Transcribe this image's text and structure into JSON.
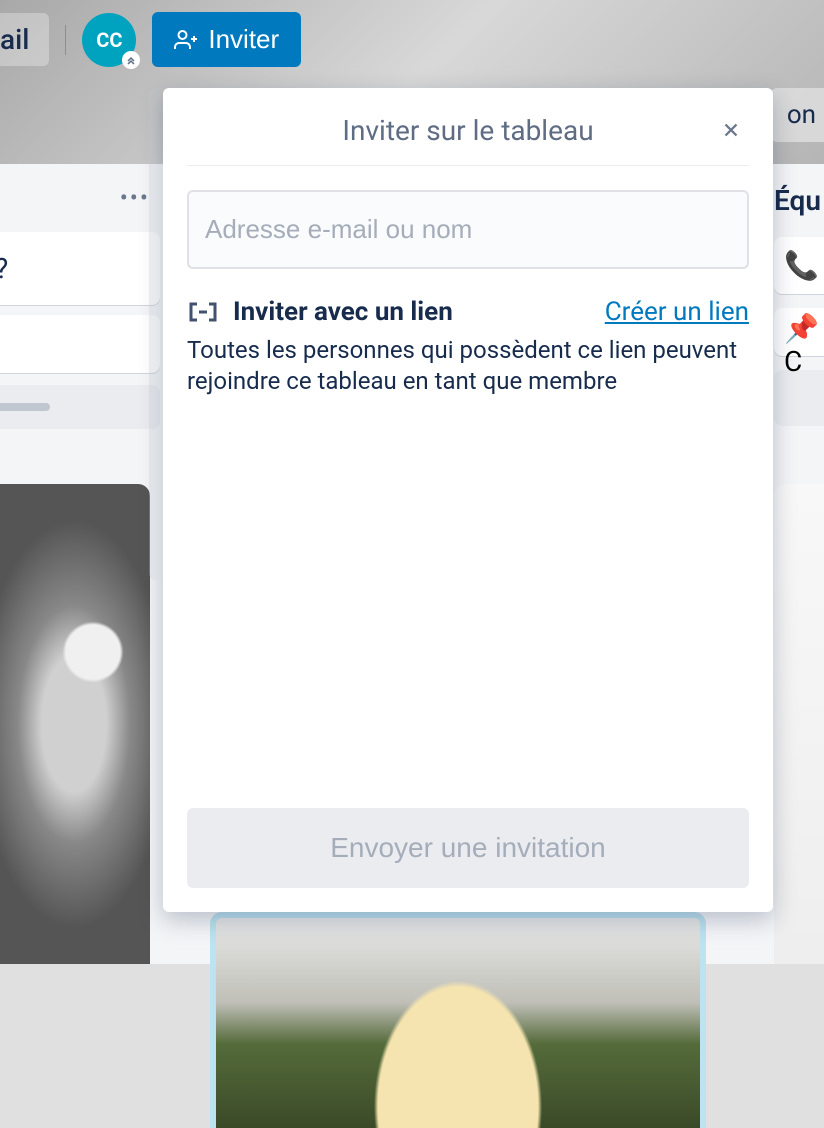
{
  "header": {
    "board_title_partial": "ail",
    "avatar_initials": "CC",
    "invite_button_label": "Inviter",
    "right_pill_partial": "on"
  },
  "left_column": {
    "card1_text": "?"
  },
  "right_column": {
    "header_partial": "Équ",
    "card1_icon": "📞",
    "card2_icon": "📌",
    "card2_text_partial": "C"
  },
  "modal": {
    "title": "Inviter sur le tableau",
    "input_placeholder": "Adresse e-mail ou nom",
    "link_section_title": "Inviter avec un lien",
    "create_link_label": "Créer un lien",
    "link_description": "Toutes les personnes qui possèdent ce lien peuvent rejoindre ce tableau en tant que membre",
    "send_button_label": "Envoyer une invitation"
  }
}
